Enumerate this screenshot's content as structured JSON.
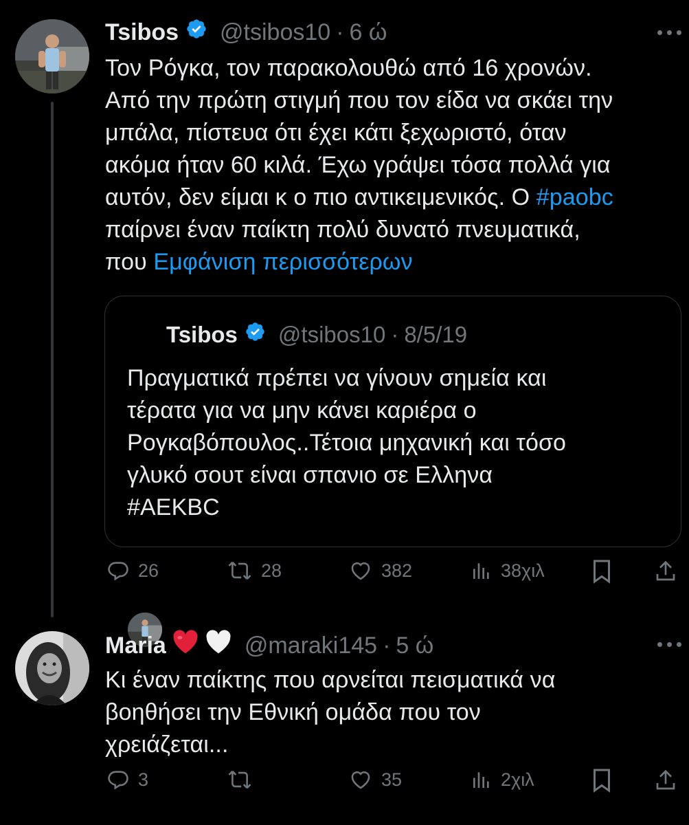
{
  "tweets": [
    {
      "name": "Tsibos",
      "handle": "@tsibos10",
      "separator": "·",
      "time": "6 ώ",
      "text_lines": [
        "Τον Ρόγκα, τον παρακολουθώ από 16 χρονών.",
        "Από την πρώτη στιγμή που τον είδα να σκάει την",
        "μπάλα, πίστευα ότι έχει κάτι ξεχωριστό, όταν",
        "ακόμα ήταν 60 κιλά. Έχω γράψει τόσα πολλά για",
        "αυτόν, δεν είμαι κ ο πιο αντικειμενικός. Ο"
      ],
      "hashtag": "#paobc",
      "text_line_7": "παίρνει έναν παίκτη πολύ δυνατό πνευματικά,",
      "text_line_8_prefix": "που",
      "show_more": "Εμφάνιση περισσότερων",
      "quote": {
        "name": "Tsibos",
        "handle": "@tsibos10",
        "separator": "·",
        "date": "8/5/19",
        "text_lines": [
          "Πραγματικά πρέπει να γίνουν σημεία και",
          "τέρατα για να μην κάνει καριέρα ο",
          "Ρογκαβόπουλος..Τέτοια μηχανική και τόσο",
          "γλυκό σουτ είναι σπανιο σε Ελληνα",
          "#AEKBC"
        ]
      },
      "actions": {
        "replies": "26",
        "retweets": "28",
        "likes": "382",
        "views": "38χιλ"
      }
    },
    {
      "name": "Maria",
      "handle": "@maraki145",
      "separator": "·",
      "time": "5 ώ",
      "text_lines": [
        "Κι έναν παίκτης που αρνείται πεισματικά να",
        "βοηθήσει την Εθνική ομάδα που τον",
        "χρειάζεται..."
      ],
      "actions": {
        "replies": "3",
        "retweets": "",
        "likes": "35",
        "views": "2χιλ"
      }
    }
  ],
  "colors": {
    "background": "#000000",
    "text": "#e7e9ea",
    "muted": "#71767b",
    "link": "#1d9bf0",
    "border": "#2f3336"
  },
  "icons": [
    "verified-badge-icon",
    "more-dots-icon",
    "reply-icon",
    "retweet-icon",
    "like-icon",
    "views-icon",
    "bookmark-icon",
    "share-icon",
    "heart-red-emoji",
    "heart-white-emoji"
  ]
}
